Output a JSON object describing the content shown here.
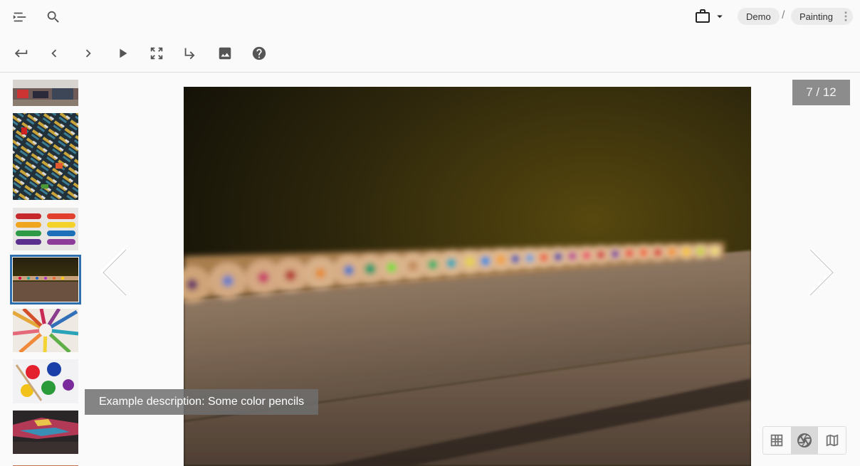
{
  "breadcrumbs": {
    "root": "Demo",
    "separator": "/",
    "current": "Painting"
  },
  "viewer": {
    "counter": "7 / 12",
    "caption": "Example description: Some color pencils"
  },
  "toolbar": {
    "top_icons": [
      "menu-expand-icon",
      "search-icon",
      "briefcase-icon",
      "caret-down-icon",
      "more-vert-icon"
    ],
    "action_icons": [
      "return-icon",
      "prev-chevron-icon",
      "next-chevron-icon",
      "play-icon",
      "fullscreen-icon",
      "subdirectory-icon",
      "image-icon",
      "help-icon"
    ]
  },
  "thumbnails": {
    "count_visible": 8,
    "active_index": 3,
    "subjects": [
      "art supplies",
      "paint tubes pile",
      "watercolor palette",
      "color pencils row",
      "pencils circle",
      "paint jars",
      "paint smears",
      "partial"
    ]
  },
  "view_modes": {
    "options": [
      "grid-icon",
      "aperture-icon",
      "map-icon"
    ],
    "selected": "aperture-icon"
  },
  "colors": {
    "active_thumb_outline": "#2f6fae",
    "counter_bg": "#8c8c8c",
    "chip_bg": "#ebebeb"
  }
}
